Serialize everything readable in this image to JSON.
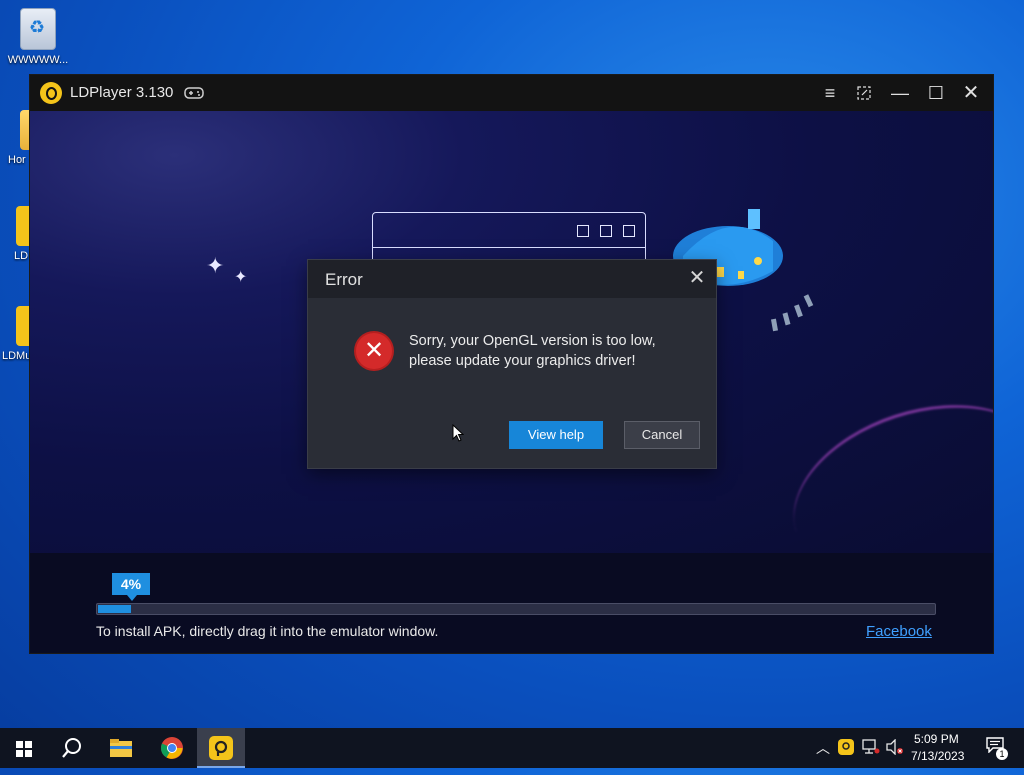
{
  "desktop": {
    "icons": [
      {
        "label": "WWWWW..."
      },
      {
        "label": "Hor"
      },
      {
        "label": "LD"
      },
      {
        "label": "LDMu"
      }
    ]
  },
  "window": {
    "title": "LDPlayer 3.130",
    "progress": {
      "percent_label": "4%",
      "value": 0.04
    },
    "install_hint": "To install APK, directly drag it into the emulator window.",
    "facebook_link": "Facebook"
  },
  "dialog": {
    "title": "Error",
    "message_line1": "Sorry, your OpenGL version is too low,",
    "message_line2": "please update your graphics driver!",
    "view_help_label": "View help",
    "cancel_label": "Cancel",
    "icon": "error-x-icon"
  },
  "taskbar": {
    "time": "5:09 PM",
    "date": "7/13/2023",
    "notification_count": "1",
    "items": [
      "start",
      "search",
      "file-explorer",
      "chrome",
      "ldplayer"
    ]
  },
  "colors": {
    "accent": "#1786d8",
    "error": "#d42a2a",
    "ldplayer_brand": "#f4c41a"
  }
}
